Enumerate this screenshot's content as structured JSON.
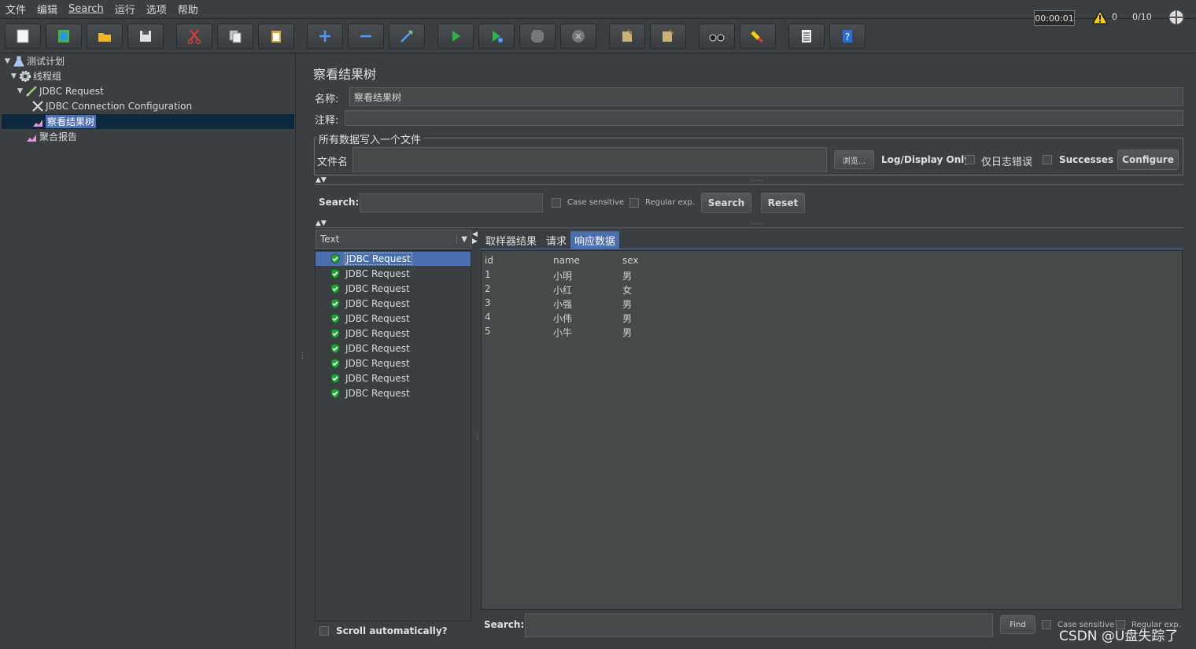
{
  "menu": [
    "文件",
    "编辑",
    "Search",
    "运行",
    "选项",
    "帮助"
  ],
  "toolbar": {
    "timer": "00:00:01",
    "warning_count": "0",
    "threads": "0/10"
  },
  "tree": {
    "items": [
      {
        "label": "测试计划",
        "icon": "test-plan-icon"
      },
      {
        "label": "线程组",
        "icon": "thread-group-icon"
      },
      {
        "label": "JDBC Request",
        "icon": "sampler-icon"
      },
      {
        "label": "JDBC Connection Configuration",
        "icon": "config-icon"
      },
      {
        "label": "察看结果树",
        "icon": "listener-icon"
      },
      {
        "label": "聚合报告",
        "icon": "listener-icon"
      }
    ]
  },
  "panel": {
    "title": "察看结果树",
    "name_label": "名称:",
    "name_value": "察看结果树",
    "comment_label": "注释:",
    "file_group_title": "所有数据写入一个文件",
    "filename_label": "文件名",
    "browse_label": "浏览...",
    "log_display_label": "Log/Display Only:",
    "errors_only_label": "仅日志错误",
    "successes_label": "Successes",
    "configure_label": "Configure"
  },
  "search": {
    "label": "Search:",
    "case_sensitive": "Case sensitive",
    "regex": "Regular exp.",
    "search_button": "Search",
    "reset_button": "Reset"
  },
  "renderer": {
    "selected": "Text"
  },
  "results": {
    "items": [
      "JDBC Request",
      "JDBC Request",
      "JDBC Request",
      "JDBC Request",
      "JDBC Request",
      "JDBC Request",
      "JDBC Request",
      "JDBC Request",
      "JDBC Request",
      "JDBC Request"
    ],
    "scroll_auto_label": "Scroll automatically?"
  },
  "tabs": [
    "取样器结果",
    "请求",
    "响应数据"
  ],
  "response": {
    "headers": [
      "id",
      "name",
      "sex"
    ],
    "rows": [
      [
        "1",
        "小明",
        "男"
      ],
      [
        "2",
        "小红",
        "女"
      ],
      [
        "3",
        "小强",
        "男"
      ],
      [
        "4",
        "小伟",
        "男"
      ],
      [
        "5",
        "小牛",
        "男"
      ]
    ]
  },
  "bottom_search": {
    "label": "Search:",
    "find_button": "Find",
    "case_sensitive": "Case sensitive",
    "regex": "Regular exp."
  },
  "watermark": "CSDN @U盘失踪了"
}
